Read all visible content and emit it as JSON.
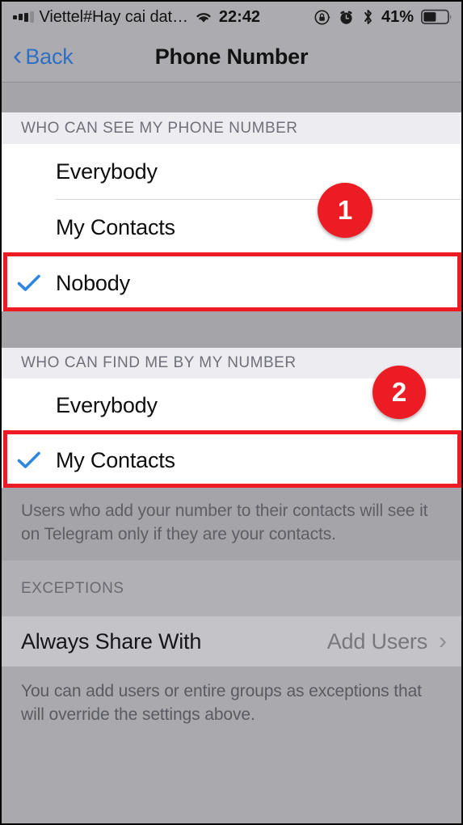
{
  "status_bar": {
    "signal_icon": "signal-bars-icon",
    "carrier": "Viettel#Hay cai dat…",
    "wifi_icon": "wifi-icon",
    "time": "22:42",
    "rotation_lock_icon": "rotation-lock-icon",
    "alarm_icon": "alarm-clock-icon",
    "bluetooth_icon": "bluetooth-icon",
    "battery_percent": "41%",
    "battery_icon": "battery-icon"
  },
  "nav": {
    "back_label": "Back",
    "back_icon": "chevron-left-icon",
    "title": "Phone Number"
  },
  "sections": [
    {
      "header": "WHO CAN SEE MY PHONE NUMBER",
      "rows": [
        {
          "label": "Everybody",
          "selected": false
        },
        {
          "label": "My Contacts",
          "selected": false
        },
        {
          "label": "Nobody",
          "selected": true
        }
      ]
    },
    {
      "header": "WHO CAN FIND ME BY MY NUMBER",
      "rows": [
        {
          "label": "Everybody",
          "selected": false
        },
        {
          "label": "My Contacts",
          "selected": true
        }
      ],
      "footnote": "Users who add your number to their contacts will see it on Telegram only if they are your contacts."
    },
    {
      "header": "EXCEPTIONS",
      "exception_row": {
        "label": "Always Share With",
        "value": "Add Users",
        "arrow_icon": "chevron-right-icon"
      },
      "footnote": "You can add users or entire groups as exceptions that will override the settings above."
    }
  ],
  "annotations": {
    "badges": [
      {
        "label": "1"
      },
      {
        "label": "2"
      }
    ],
    "highlight_color": "#ee1b24",
    "badge_color": "#ec1c24"
  },
  "theme": {
    "check_color": "#2f86e0",
    "link_color": "#2f6fc4",
    "chrome_bg": "#acacb0",
    "row_bg": "#ffffff",
    "section_header_bg": "#edecf1"
  }
}
